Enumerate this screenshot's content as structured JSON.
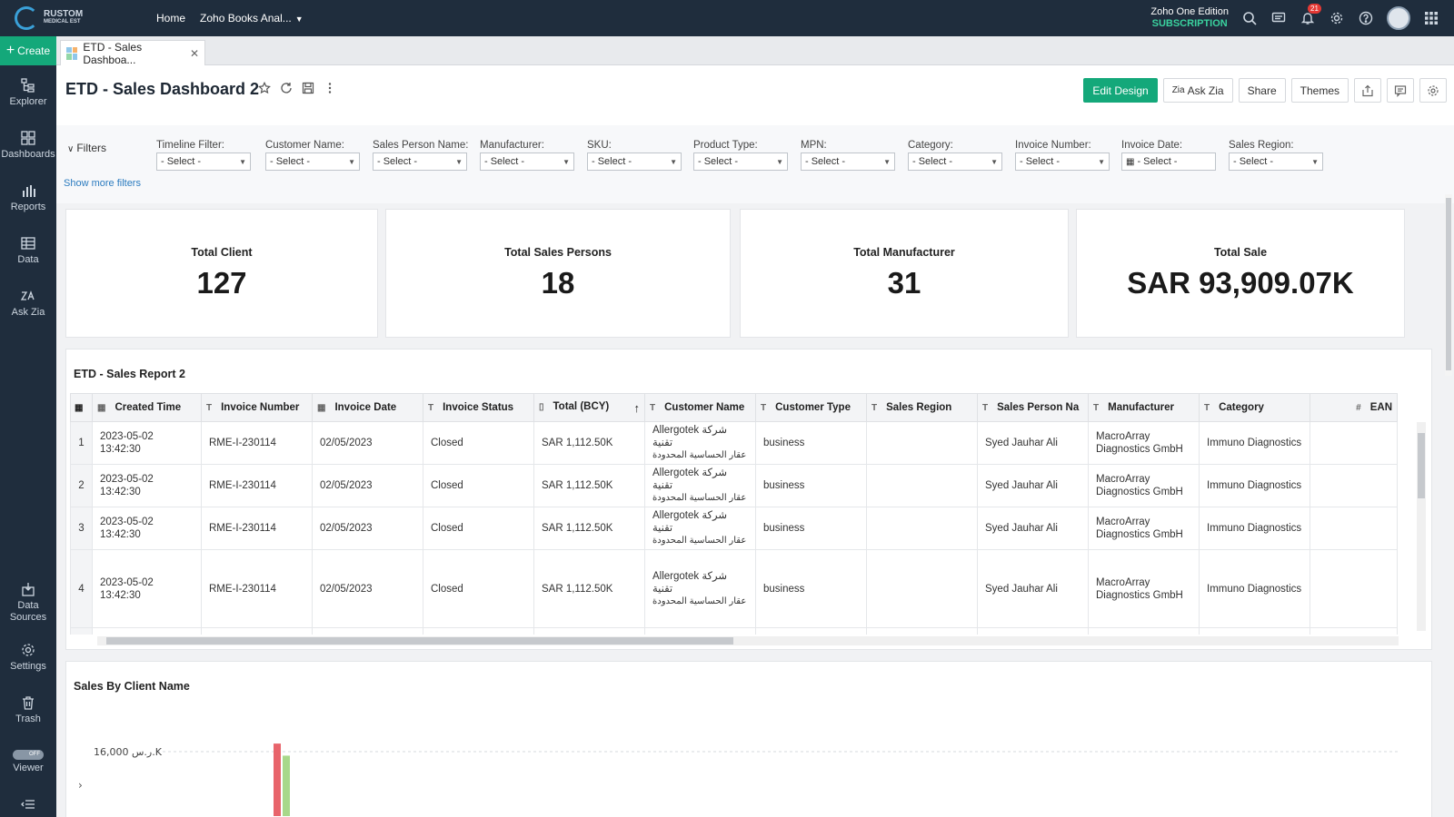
{
  "brand": {
    "name": "RUSTOM",
    "sub": "MEDICAL EST"
  },
  "topnav": {
    "home": "Home",
    "workspace": "Zoho Books Anal..."
  },
  "edition": {
    "line1": "Zoho One Edition",
    "line2": "SUBSCRIPTION"
  },
  "notifications": {
    "count": "21"
  },
  "sidebar": {
    "create": "Create",
    "items": [
      "Explorer",
      "Dashboards",
      "Reports",
      "Data",
      "Ask Zia"
    ],
    "bottom": [
      "Data Sources",
      "Settings",
      "Trash",
      "Viewer"
    ],
    "toggle": "OFF"
  },
  "tab": {
    "label": "ETD - Sales Dashboa..."
  },
  "header": {
    "title": "ETD - Sales Dashboard 2",
    "edit_design": "Edit Design",
    "ask_zia": "Ask Zia",
    "share": "Share",
    "themes": "Themes"
  },
  "filters": {
    "label": "Filters",
    "show_more": "Show more filters",
    "items": [
      {
        "label": "Timeline Filter:",
        "value": "- Select -"
      },
      {
        "label": "Customer Name:",
        "value": "- Select -"
      },
      {
        "label": "Sales Person Name:",
        "value": "- Select -"
      },
      {
        "label": "Manufacturer:",
        "value": "- Select -"
      },
      {
        "label": "SKU:",
        "value": "- Select -"
      },
      {
        "label": "Product Type:",
        "value": "- Select -"
      },
      {
        "label": "MPN:",
        "value": "- Select -"
      },
      {
        "label": "Category:",
        "value": "- Select -"
      },
      {
        "label": "Invoice Number:",
        "value": "- Select -"
      },
      {
        "label": "Invoice Date:",
        "value": "- Select -"
      },
      {
        "label": "Sales Region:",
        "value": "- Select -"
      }
    ]
  },
  "kpis": [
    {
      "title": "Total Client",
      "value": "127"
    },
    {
      "title": "Total Sales Persons",
      "value": "18"
    },
    {
      "title": "Total Manufacturer",
      "value": "31"
    },
    {
      "title": "Total Sale",
      "value": "SAR 93,909.07K"
    }
  ],
  "report": {
    "title": "ETD - Sales Report 2",
    "columns": [
      {
        "type": "▦",
        "label": "Created Time"
      },
      {
        "type": "T",
        "label": "Invoice Number"
      },
      {
        "type": "▦",
        "label": "Invoice Date"
      },
      {
        "type": "T",
        "label": "Invoice Status"
      },
      {
        "type": "▯",
        "label": "Total (BCY)"
      },
      {
        "type": "T",
        "label": "Customer Name"
      },
      {
        "type": "T",
        "label": "Customer Type"
      },
      {
        "type": "T",
        "label": "Sales Region"
      },
      {
        "type": "T",
        "label": "Sales Person Na"
      },
      {
        "type": "T",
        "label": "Manufacturer"
      },
      {
        "type": "T",
        "label": "Category"
      },
      {
        "type": "#",
        "label": "EAN"
      }
    ],
    "rows": [
      {
        "n": "1",
        "created": "2023-05-02 13:42:30",
        "invoice": "RME-I-230114",
        "date": "02/05/2023",
        "status": "Closed",
        "total": "SAR 1,112.50K",
        "customer": "Allergotek شركة تقنية",
        "customer_ar": "عقار الحساسية المحدودة",
        "ctype": "business",
        "region": "",
        "person": "Syed Jauhar Ali",
        "manufacturer": "MacroArray Diagnostics GmbH",
        "category": "Immuno Diagnostics",
        "ean": ""
      },
      {
        "n": "2",
        "created": "2023-05-02 13:42:30",
        "invoice": "RME-I-230114",
        "date": "02/05/2023",
        "status": "Closed",
        "total": "SAR 1,112.50K",
        "customer": "Allergotek شركة تقنية",
        "customer_ar": "عقار الحساسية المحدودة",
        "ctype": "business",
        "region": "",
        "person": "Syed Jauhar Ali",
        "manufacturer": "MacroArray Diagnostics GmbH",
        "category": "Immuno Diagnostics",
        "ean": ""
      },
      {
        "n": "3",
        "created": "2023-05-02 13:42:30",
        "invoice": "RME-I-230114",
        "date": "02/05/2023",
        "status": "Closed",
        "total": "SAR 1,112.50K",
        "customer": "Allergotek شركة تقنية",
        "customer_ar": "عقار الحساسية المحدودة",
        "ctype": "business",
        "region": "",
        "person": "Syed Jauhar Ali",
        "manufacturer": "MacroArray Diagnostics GmbH",
        "category": "Immuno Diagnostics",
        "ean": ""
      },
      {
        "n": "4",
        "created": "2023-05-02 13:42:30",
        "invoice": "RME-I-230114",
        "date": "02/05/2023",
        "status": "Closed",
        "total": "SAR 1,112.50K",
        "customer": "Allergotek شركة تقنية",
        "customer_ar": "عقار الحساسية المحدودة",
        "ctype": "business",
        "region": "",
        "person": "Syed Jauhar Ali",
        "manufacturer": "MacroArray Diagnostics GmbH",
        "category": "Immuno Diagnostics",
        "ean": ""
      }
    ]
  },
  "chart": {
    "title": "Sales By Client Name",
    "y_tick": "16,000 ر.س.K"
  },
  "chart_data": {
    "type": "bar",
    "title": "Sales By Client Name",
    "xlabel": "",
    "ylabel": "",
    "y_ticks": [
      "16,000 ر.س.K"
    ],
    "series": [
      {
        "color": "#e8646b",
        "values": [
          18000
        ]
      },
      {
        "color": "#a8d88a",
        "values": [
          15000
        ]
      }
    ],
    "ylim": [
      0,
      20000
    ],
    "grid": true
  }
}
